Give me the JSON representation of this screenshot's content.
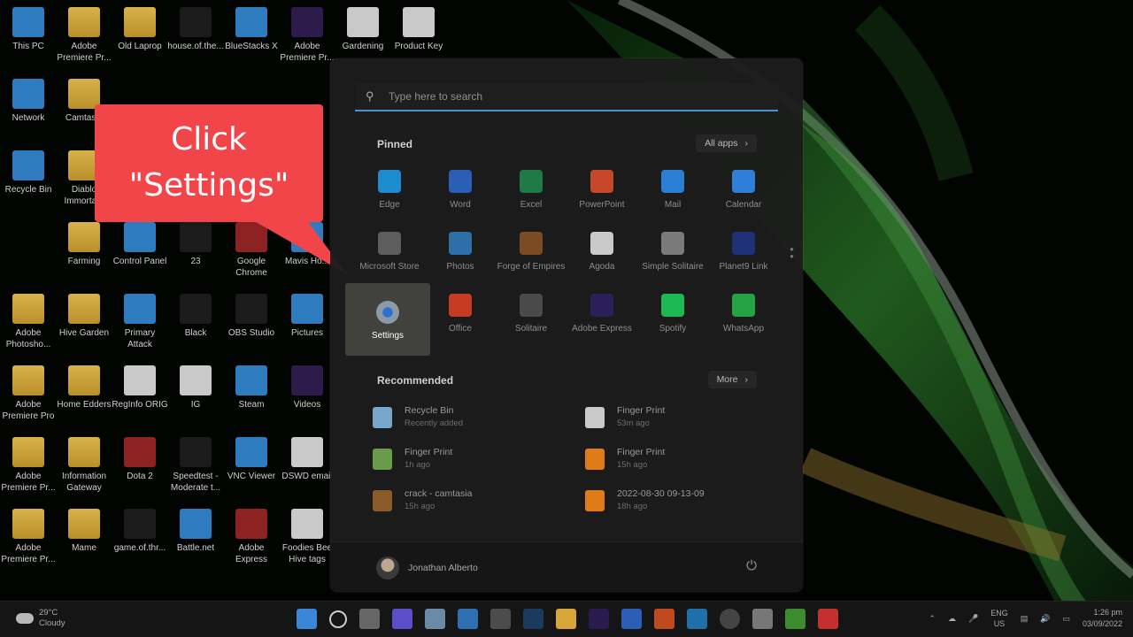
{
  "desktop": {
    "icons": [
      {
        "label": "This PC",
        "type": "blue"
      },
      {
        "label": "Adobe Premiere Pr...",
        "type": "folder"
      },
      {
        "label": "Old Laprop",
        "type": "folder"
      },
      {
        "label": "house.of.the...",
        "type": "dark"
      },
      {
        "label": "BlueStacks X",
        "type": "blue"
      },
      {
        "label": "Adobe Premiere Pr...",
        "type": "purple"
      },
      {
        "label": "Gardening",
        "type": "doc"
      },
      {
        "label": "Product Key",
        "type": "doc"
      },
      {
        "label": "Network",
        "type": "blue"
      },
      {
        "label": "Camtasia",
        "type": "folder"
      },
      {
        "label": "Recycle Bin",
        "type": "blue"
      },
      {
        "label": "Diablo Immorta...",
        "type": "folder"
      },
      {
        "label": "Farming",
        "type": "folder"
      },
      {
        "label": "Control Panel",
        "type": "blue"
      },
      {
        "label": "23",
        "type": "dark"
      },
      {
        "label": "Google Chrome",
        "type": "red"
      },
      {
        "label": "Mavis Ho...",
        "type": "blue"
      },
      {
        "label": "Adobe Photosho...",
        "type": "folder"
      },
      {
        "label": "Hive Garden",
        "type": "folder"
      },
      {
        "label": "Primary Attack",
        "type": "blue"
      },
      {
        "label": "Black",
        "type": "dark"
      },
      {
        "label": "OBS Studio",
        "type": "dark"
      },
      {
        "label": "Pictures",
        "type": "blue"
      },
      {
        "label": "Adobe Premiere Pro",
        "type": "folder"
      },
      {
        "label": "Home Edders",
        "type": "folder"
      },
      {
        "label": "RegInfo ORIG",
        "type": "doc"
      },
      {
        "label": "IG",
        "type": "doc"
      },
      {
        "label": "Steam",
        "type": "blue"
      },
      {
        "label": "Videos",
        "type": "purple"
      },
      {
        "label": "Adobe Premiere Pr...",
        "type": "folder"
      },
      {
        "label": "Information Gateway",
        "type": "folder"
      },
      {
        "label": "Dota 2",
        "type": "red"
      },
      {
        "label": "Speedtest - Moderate t...",
        "type": "dark"
      },
      {
        "label": "VNC Viewer",
        "type": "blue"
      },
      {
        "label": "DSWD email",
        "type": "doc"
      },
      {
        "label": "Adobe Premiere Pr...",
        "type": "folder"
      },
      {
        "label": "Mame",
        "type": "folder"
      },
      {
        "label": "game.of.thr...",
        "type": "dark"
      },
      {
        "label": "Battle.net",
        "type": "blue"
      },
      {
        "label": "Adobe Express",
        "type": "red"
      },
      {
        "label": "Foodies Bee Hive tags",
        "type": "doc"
      }
    ]
  },
  "callout": {
    "line1": "Click",
    "line2": "\"Settings\"",
    "color": "#f2454a"
  },
  "start_menu": {
    "search_placeholder": "Type here to search",
    "pinned_title": "Pinned",
    "all_apps_label": "All apps",
    "pinned_apps": [
      {
        "label": "Edge",
        "color": "#1c8ccf"
      },
      {
        "label": "Word",
        "color": "#2b5fb6"
      },
      {
        "label": "Excel",
        "color": "#1f7a45"
      },
      {
        "label": "PowerPoint",
        "color": "#c7472b"
      },
      {
        "label": "Mail",
        "color": "#2a7fd4"
      },
      {
        "label": "Calendar",
        "color": "#2f7fd8"
      },
      {
        "label": "Microsoft Store",
        "color": "#5d5d5d"
      },
      {
        "label": "Photos",
        "color": "#2d6fa8"
      },
      {
        "label": "Forge of Empires",
        "color": "#7b4b24"
      },
      {
        "label": "Agoda",
        "color": "#c9c9c9"
      },
      {
        "label": "Simple Solitaire",
        "color": "#7a7a7a"
      },
      {
        "label": "Planet9 Link",
        "color": "#1f2f78"
      },
      {
        "label": "Settings",
        "color": "#5a6b78"
      },
      {
        "label": "Office",
        "color": "#c63b23"
      },
      {
        "label": "Solitaire",
        "color": "#4a4a4a"
      },
      {
        "label": "Adobe Express",
        "color": "#2a1f5a"
      },
      {
        "label": "Spotify",
        "color": "#1db954"
      },
      {
        "label": "WhatsApp",
        "color": "#25a244"
      }
    ],
    "recommended_title": "Recommended",
    "more_label": "More",
    "recommended": [
      {
        "name": "Recycle Bin",
        "time": "Recently added",
        "color": "#7aa6c9"
      },
      {
        "name": "Finger Print",
        "time": "53m ago",
        "color": "#c9c9c9"
      },
      {
        "name": "Finger Print",
        "time": "1h ago",
        "color": "#6a9b4a"
      },
      {
        "name": "Finger Print",
        "time": "15h ago",
        "color": "#e07b1a"
      },
      {
        "name": "crack - camtasia",
        "time": "15h ago",
        "color": "#8b5a2b"
      },
      {
        "name": "2022-08-30 09-13-09",
        "time": "18h ago",
        "color": "#e07b1a"
      }
    ],
    "user_name": "Jonathan Alberto"
  },
  "taskbar": {
    "weather_temp": "29°C",
    "weather_text": "Cloudy",
    "lang_line1": "ENG",
    "lang_line2": "US",
    "time": "1:26 pm",
    "date": "03/09/2022"
  }
}
